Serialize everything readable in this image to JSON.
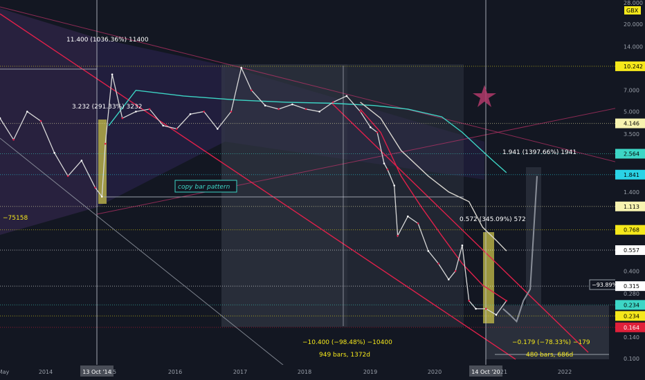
{
  "chart_data": {
    "type": "line",
    "title": "",
    "scale": "log",
    "ylim": [
      0.1,
      28.0
    ],
    "price_axis_ticks": [
      {
        "value": 28.0,
        "label": "28.000"
      },
      {
        "value": 20.0,
        "label": "20.000"
      },
      {
        "value": 14.0,
        "label": "14.000"
      },
      {
        "value": 7.0,
        "label": "7.000"
      },
      {
        "value": 5.0,
        "label": "5.000"
      },
      {
        "value": 3.5,
        "label": "3.500"
      },
      {
        "value": 1.4,
        "label": "1.400"
      },
      {
        "value": 0.4,
        "label": "0.400"
      },
      {
        "value": 0.28,
        "label": "0.280"
      },
      {
        "value": 0.14,
        "label": "0.140"
      },
      {
        "value": 0.1,
        "label": "0.100"
      }
    ],
    "price_labels": [
      {
        "value": 10.242,
        "label": "10.242",
        "color": "#f5e81b",
        "text_color": "#000000"
      },
      {
        "value": 4.146,
        "label": "4.146",
        "color": "#f7f3b0",
        "text_color": "#000000"
      },
      {
        "value": 2.564,
        "label": "2.564",
        "color": "#3dd6c6",
        "text_color": "#000000"
      },
      {
        "value": 1.841,
        "label": "1.841",
        "color": "#2ad3e6",
        "text_color": "#000000"
      },
      {
        "value": 1.113,
        "label": "1.113",
        "color": "#f7f3b0",
        "text_color": "#000000"
      },
      {
        "value": 0.768,
        "label": "0.768",
        "color": "#f5e81b",
        "text_color": "#000000"
      },
      {
        "value": 0.557,
        "label": "0.557",
        "color": "#ffffff",
        "text_color": "#000000"
      },
      {
        "value": 0.315,
        "label": "0.315",
        "color": "#ffffff",
        "text_color": "#000000"
      },
      {
        "value": 0.234,
        "label": "0.234",
        "color": "#3dd6c6",
        "text_color": "#000000"
      },
      {
        "value": 0.234,
        "label": "0.234",
        "color": "#f5e81b",
        "text_color": "#000000"
      },
      {
        "value": 0.164,
        "label": "0.164",
        "color": "#e0203a",
        "text_color": "#ffffff"
      }
    ],
    "currency_label": "GBX",
    "x_ticks": [
      "May",
      "2014",
      "13 Oct '14",
      "15",
      "2016",
      "2017",
      "2018",
      "2019",
      "2020",
      "14 Oct '20",
      "21",
      "2022"
    ],
    "cursor_dates": [
      "13 Oct '14",
      "14 Oct '20"
    ],
    "price_series": {
      "name": "",
      "dates": [
        2013.3,
        2013.5,
        2013.7,
        2013.9,
        2014.1,
        2014.3,
        2014.5,
        2014.7,
        2014.8,
        2014.85,
        2014.95,
        2015.1,
        2015.3,
        2015.5,
        2015.7,
        2015.9,
        2016.1,
        2016.3,
        2016.5,
        2016.7,
        2016.85,
        2017.0,
        2017.2,
        2017.4,
        2017.6,
        2017.8,
        2018.0,
        2018.2,
        2018.4,
        2018.6,
        2018.75,
        2018.85,
        2018.95,
        2019.0,
        2019.1,
        2019.15,
        2019.3,
        2019.45,
        2019.6,
        2019.75,
        2019.9,
        2020.0,
        2020.1,
        2020.2,
        2020.3,
        2020.45,
        2020.6,
        2020.75
      ],
      "values": [
        4.5,
        3.2,
        5.0,
        4.3,
        2.6,
        1.8,
        2.3,
        1.5,
        1.3,
        3.0,
        9.0,
        4.5,
        5.0,
        5.2,
        4.0,
        3.8,
        4.8,
        5.0,
        3.8,
        5.0,
        10.0,
        7.0,
        5.5,
        5.2,
        5.6,
        5.2,
        5.0,
        5.8,
        6.4,
        5.0,
        3.9,
        3.6,
        2.2,
        2.0,
        1.55,
        0.7,
        0.95,
        0.85,
        0.55,
        0.45,
        0.35,
        0.4,
        0.6,
        0.25,
        0.22,
        0.22,
        0.2,
        0.25
      ]
    },
    "previous_cycle_series": {
      "name": "",
      "dates": [
        2020.7,
        2020.8,
        2020.9,
        2021.0,
        2021.1,
        2021.2
      ],
      "values": [
        0.22,
        0.2,
        0.18,
        0.25,
        0.3,
        1.8
      ]
    },
    "moving_averages": [
      {
        "color": "#3dd6c6",
        "dates": [
          2014.9,
          2015.3,
          2016.0,
          2016.8,
          2017.5,
          2018.2,
          2018.8,
          2019.3,
          2019.8,
          2020.1,
          2020.35,
          2020.55,
          2020.75
        ],
        "values": [
          4.0,
          7.0,
          6.4,
          6.0,
          5.8,
          5.7,
          5.5,
          5.2,
          4.6,
          3.6,
          2.8,
          2.3,
          1.9
        ]
      },
      {
        "color": "#d9d6cf",
        "dates": [
          2018.6,
          2018.9,
          2019.2,
          2019.6,
          2019.9,
          2020.2,
          2020.4,
          2020.6,
          2020.75
        ],
        "values": [
          5.8,
          4.5,
          2.7,
          1.8,
          1.4,
          1.2,
          0.8,
          0.65,
          0.55
        ]
      },
      {
        "color": "#e0204a",
        "dates": [
          2018.6,
          2018.9,
          2019.2,
          2019.5,
          2019.8,
          2020.1,
          2020.4,
          2020.75
        ],
        "values": [
          5.2,
          3.6,
          1.8,
          1.1,
          0.7,
          0.45,
          0.32,
          0.25
        ]
      }
    ],
    "annotations": [
      {
        "text": "11.400 (1036.36%) 11400",
        "color": "#ffffff"
      },
      {
        "text": "3.232 (291.33%) 3232",
        "color": "#ffffff"
      },
      {
        "text": "−75158",
        "color": "#f5e81b"
      },
      {
        "text": "copy bar pattern",
        "color": "#3dd6c6"
      },
      {
        "text": "−10.400 (−98.48%) −10400",
        "color": "#f5e81b"
      },
      {
        "text": "949 bars, 1372d",
        "color": "#f5e81b"
      },
      {
        "text": "0.572 (345.09%) 572",
        "color": "#ffffff"
      },
      {
        "text": "1.941 (1397.66%) 1941",
        "color": "#ffffff"
      },
      {
        "text": "−0.179 (−78.33%) −179",
        "color": "#f5e81b"
      },
      {
        "text": "480 bars, 686d",
        "color": "#f5e81b"
      },
      {
        "text": "−93.89%",
        "color": "#ffffff"
      }
    ]
  }
}
